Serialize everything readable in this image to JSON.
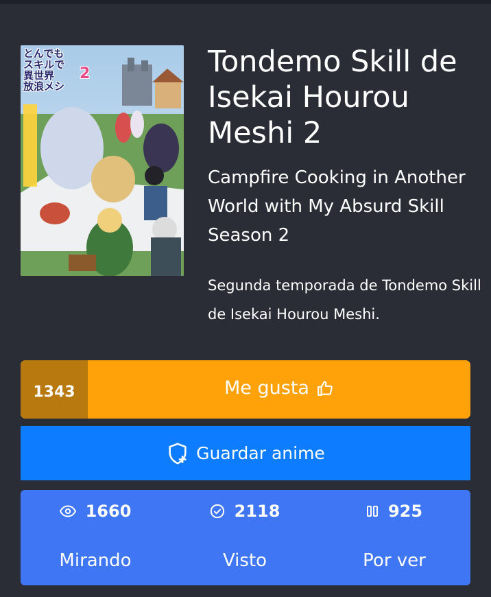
{
  "anime": {
    "title": "Tondemo Skill de Isekai Hourou Meshi 2",
    "subtitle": "Campfire Cooking in Another World with My Absurd Skill Season 2",
    "description": "Segunda temporada de Tondemo Skill de Isekai Hourou Meshi.",
    "poster": {
      "logo_line1": "とんでも",
      "logo_line2": "スキルで",
      "logo_line3": "異世界",
      "logo_line4": "放浪メシ",
      "logo_number": "2"
    }
  },
  "like": {
    "count": "1343",
    "label": "Me gusta",
    "icon": "thumbs-up-icon",
    "color": "#ffa20a",
    "count_bg": "#b87a0e"
  },
  "save": {
    "label": "Guardar anime",
    "icon": "shield-plus-icon",
    "color": "#0d7cff"
  },
  "stats": {
    "color": "#3f76f4",
    "items": [
      {
        "icon": "eye-icon",
        "count": "1660",
        "label": "Mirando"
      },
      {
        "icon": "check-circle-icon",
        "count": "2118",
        "label": "Visto"
      },
      {
        "icon": "pause-icon",
        "count": "925",
        "label": "Por ver"
      }
    ]
  }
}
